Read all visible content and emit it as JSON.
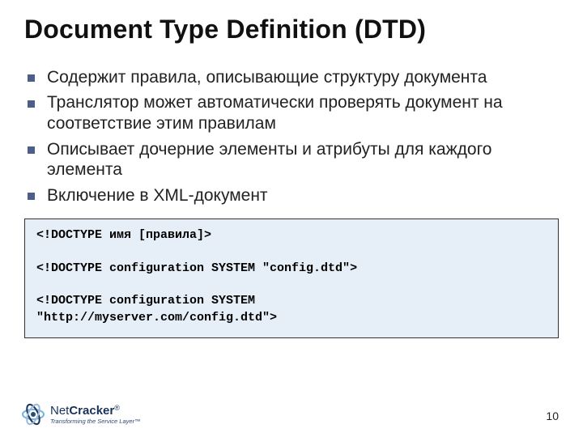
{
  "title": "Document Type Definition (DTD)",
  "bullets": [
    "Содержит правила, описывающие структуру документа",
    "Транслятор может автоматически проверять документ на соответствие этим правилам",
    "Описывает дочерние элементы и атрибуты для каждого элемента",
    "Включение в XML-документ"
  ],
  "code": "<!DOCTYPE имя [правила]>\n\n<!DOCTYPE configuration SYSTEM \"config.dtd\">\n\n<!DOCTYPE configuration SYSTEM\n\"http://myserver.com/config.dtd\">",
  "footer": {
    "brand_prefix": "Net",
    "brand_bold": "Cracker",
    "reg": "®",
    "tagline": "Transforming the Service Layer™",
    "page": "10"
  }
}
